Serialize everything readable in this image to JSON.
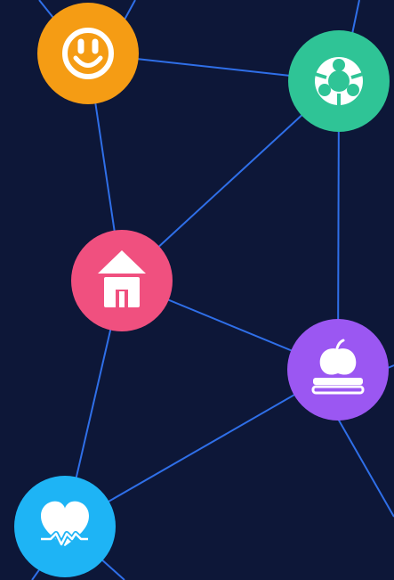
{
  "colors": {
    "background": "#0d1738",
    "edge": "#2f6fe8",
    "icon": "#ffffff"
  },
  "nodes": [
    {
      "id": "smile",
      "name": "smiley-face-node",
      "icon": "smiley-face-icon",
      "color": "#f59c14"
    },
    {
      "id": "team",
      "name": "people-circle-node",
      "icon": "people-circle-icon",
      "color": "#2fc496"
    },
    {
      "id": "home",
      "name": "home-node",
      "icon": "house-icon",
      "color": "#f0507f"
    },
    {
      "id": "edu",
      "name": "education-node",
      "icon": "apple-on-books-icon",
      "color": "#9b57f2"
    },
    {
      "id": "health",
      "name": "health-node",
      "icon": "heart-pulse-icon",
      "color": "#1eb4f5"
    }
  ],
  "edges": [
    [
      "smile",
      "team"
    ],
    [
      "smile",
      "home"
    ],
    [
      "team",
      "home"
    ],
    [
      "team",
      "edu"
    ],
    [
      "home",
      "edu"
    ],
    [
      "home",
      "health"
    ],
    [
      "edu",
      "health"
    ]
  ]
}
